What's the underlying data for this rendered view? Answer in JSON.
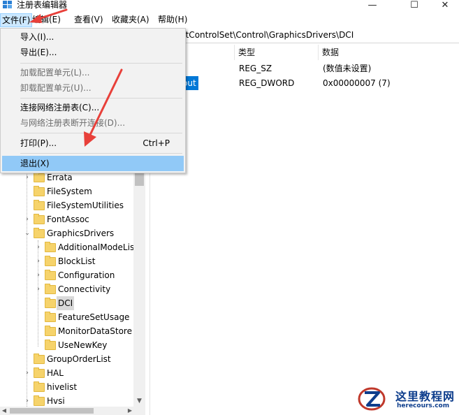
{
  "window": {
    "title": "注册表编辑器",
    "minimize_glyph": "—",
    "maximize_glyph": "☐",
    "close_glyph": "✕"
  },
  "menubar": {
    "items": [
      "文件(F)",
      "编辑(E)",
      "查看(V)",
      "收藏夹(A)",
      "帮助(H)"
    ]
  },
  "address": {
    "path_visible": "ntControlSet\\Control\\GraphicsDrivers\\DCI"
  },
  "file_menu": {
    "items": [
      {
        "label": "导入(I)...",
        "enabled": true
      },
      {
        "label": "导出(E)...",
        "enabled": true
      },
      {
        "label": "加载配置单元(L)...",
        "enabled": false
      },
      {
        "label": "卸载配置单元(U)...",
        "enabled": false
      },
      {
        "label": "连接网络注册表(C)...",
        "enabled": true
      },
      {
        "label": "与网络注册表断开连接(D)...",
        "enabled": false
      },
      {
        "label": "打印(P)...",
        "shortcut": "Ctrl+P",
        "enabled": true
      },
      {
        "label": "退出(X)",
        "enabled": true,
        "highlighted": true
      }
    ]
  },
  "tree": {
    "items": [
      {
        "label": "Errata",
        "expander": "›"
      },
      {
        "label": "FileSystem",
        "expander": ""
      },
      {
        "label": "FileSystemUtilities",
        "expander": ""
      },
      {
        "label": "FontAssoc",
        "expander": "›"
      },
      {
        "label": "GraphicsDrivers",
        "expander": "⌄"
      },
      {
        "label": "AdditionalModeLis",
        "expander": "›"
      },
      {
        "label": "BlockList",
        "expander": "›"
      },
      {
        "label": "Configuration",
        "expander": "›"
      },
      {
        "label": "Connectivity",
        "expander": "›"
      },
      {
        "label": "DCI",
        "expander": "",
        "selected": true
      },
      {
        "label": "FeatureSetUsage",
        "expander": ""
      },
      {
        "label": "MonitorDataStore",
        "expander": ""
      },
      {
        "label": "UseNewKey",
        "expander": ""
      },
      {
        "label": "GroupOrderList",
        "expander": ""
      },
      {
        "label": "HAL",
        "expander": "›"
      },
      {
        "label": "hivelist",
        "expander": ""
      },
      {
        "label": "Hvsi",
        "expander": "›"
      }
    ]
  },
  "values_pane": {
    "headers": {
      "type": "类型",
      "data": "数据"
    },
    "rows": [
      {
        "name_fragment": ")",
        "type": "REG_SZ",
        "data": "(数值未设置)"
      },
      {
        "name_fragment": "out",
        "type": "REG_DWORD",
        "data": "0x00000007 (7)",
        "selected": true
      }
    ]
  },
  "watermark": {
    "site_name": "这里教程网",
    "site_url": "herecours.com"
  },
  "colors": {
    "selection_blue": "#0078d7",
    "menu_highlight": "#91c9f7",
    "annotation_red": "#e8403a",
    "folder_yellow": "#f6d36b"
  }
}
